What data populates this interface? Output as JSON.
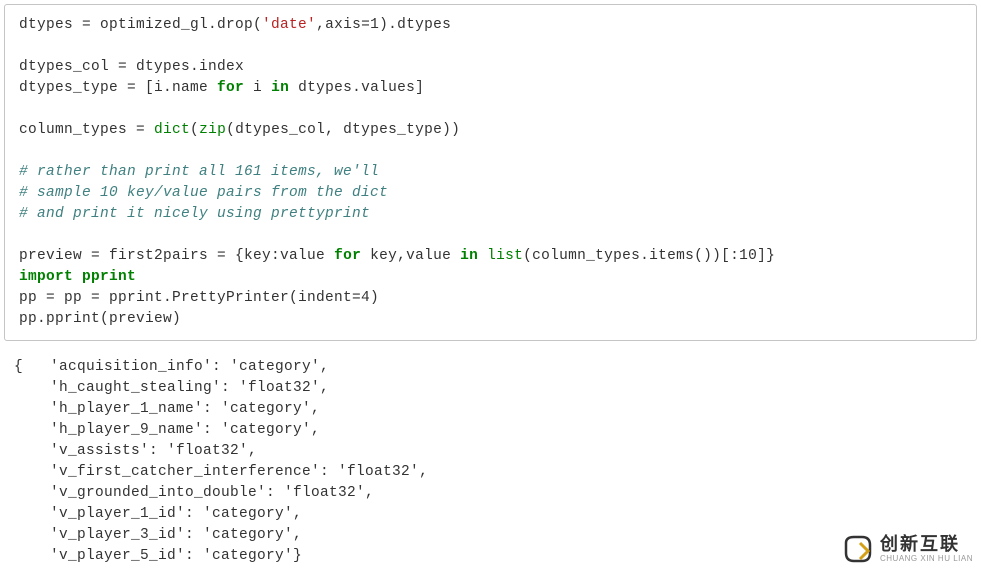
{
  "code": {
    "l1a": "dtypes = optimized_gl.drop(",
    "l1b": "'date'",
    "l1c": ",axis=1).dtypes",
    "blank": "",
    "l2": "dtypes_col = dtypes.index",
    "l3a": "dtypes_type = [i.name ",
    "kw_for": "for",
    "l3b": " i ",
    "kw_in": "in",
    "l3c": " dtypes.values]",
    "l4a": "column_types = ",
    "fn_dict": "dict",
    "l4b": "(",
    "fn_zip": "zip",
    "l4c": "(dtypes_col, dtypes_type))",
    "c1": "# rather than print all 161 items, we'll",
    "c2": "# sample 10 key/value pairs from the dict",
    "c3": "# and print it nicely using prettyprint",
    "l5a": "preview = first2pairs = {key:value ",
    "l5b": " key,value ",
    "l5c": " ",
    "fn_list": "list",
    "l5d": "(column_types.items())[:10]}",
    "kw_import": "import",
    "l6": " pprint",
    "l7": "pp = pp = pprint.PrettyPrinter(indent=4)",
    "l8": "pp.pprint(preview)"
  },
  "output": {
    "l1": "{   'acquisition_info': 'category',",
    "l2": "    'h_caught_stealing': 'float32',",
    "l3": "    'h_player_1_name': 'category',",
    "l4": "    'h_player_9_name': 'category',",
    "l5": "    'v_assists': 'float32',",
    "l6": "    'v_first_catcher_interference': 'float32',",
    "l7": "    'v_grounded_into_double': 'float32',",
    "l8": "    'v_player_1_id': 'category',",
    "l9": "    'v_player_3_id': 'category',",
    "l10": "    'v_player_5_id': 'category'}"
  },
  "logo": {
    "cn": "创新互联",
    "en": "CHUANG XIN HU LIAN"
  }
}
